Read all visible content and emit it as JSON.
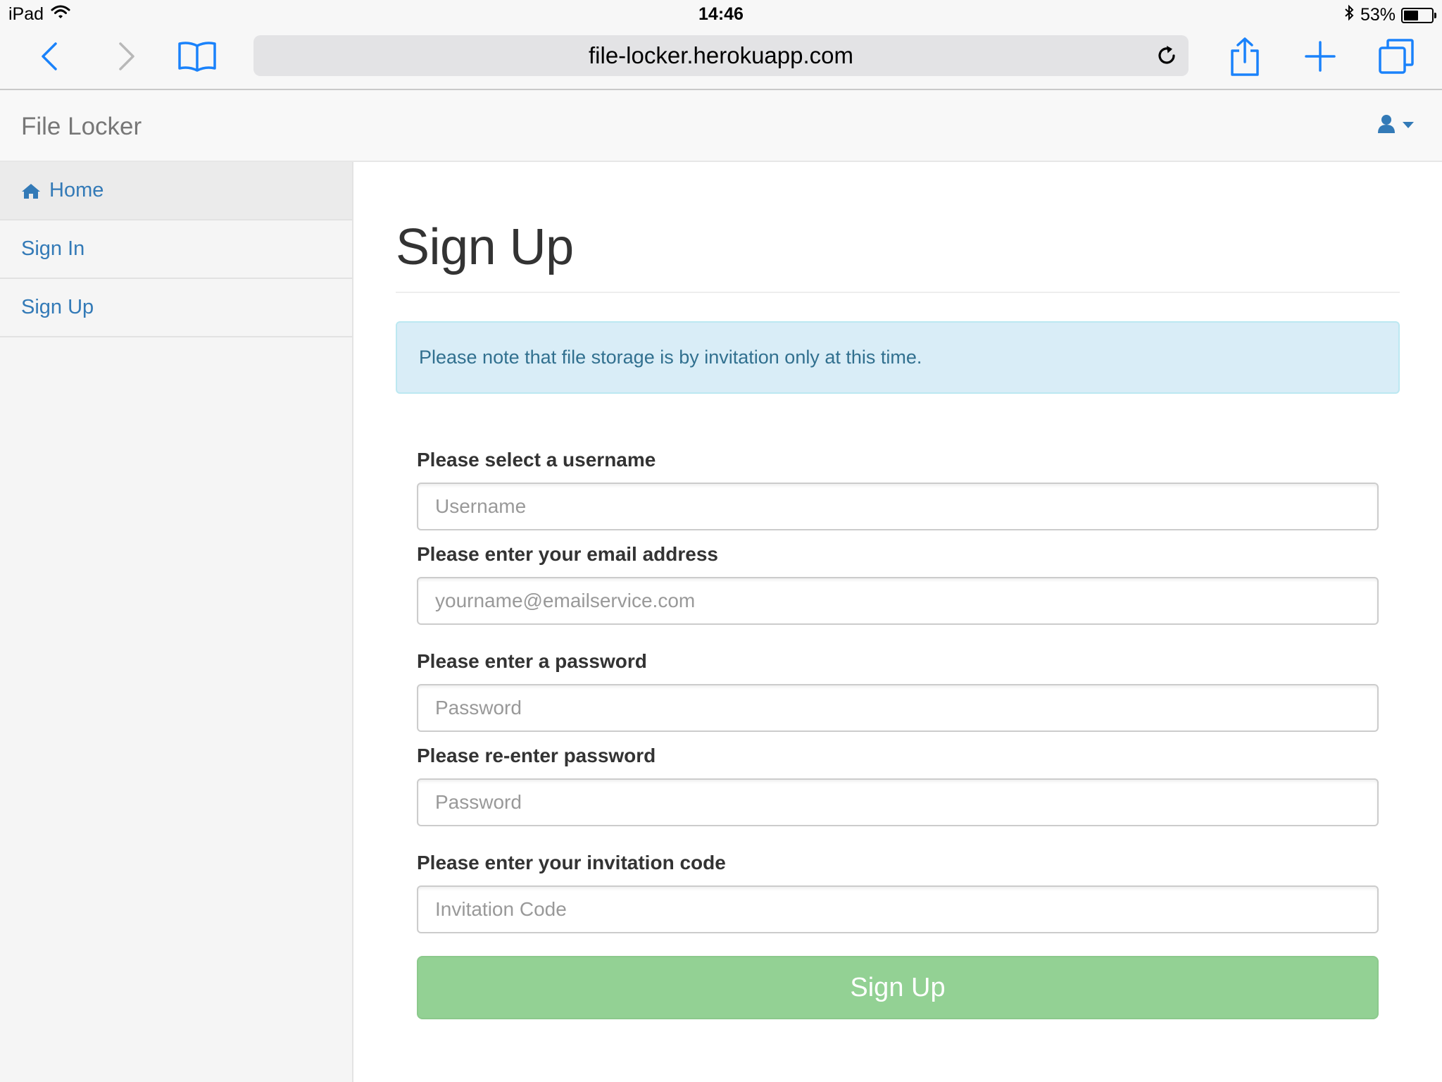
{
  "status_bar": {
    "device": "iPad",
    "time": "14:46",
    "battery_percent": "53%",
    "battery_level": 0.53
  },
  "browser": {
    "url": "file-locker.herokuapp.com",
    "icons": [
      "back-icon",
      "forward-icon",
      "bookmarks-icon",
      "reload-icon",
      "share-icon",
      "new-tab-icon",
      "tabs-icon"
    ]
  },
  "navbar": {
    "brand": "File Locker",
    "user_icon": "user-icon"
  },
  "sidebar": {
    "items": [
      {
        "label": "Home",
        "icon": "home-icon",
        "active": true
      },
      {
        "label": "Sign In"
      },
      {
        "label": "Sign Up"
      }
    ]
  },
  "main": {
    "title": "Sign Up",
    "alert": "Please note that file storage is by invitation only at this time.",
    "form": {
      "username_label": "Please select a username",
      "username_placeholder": "Username",
      "email_label": "Please enter your email address",
      "email_placeholder": "yourname@emailservice.com",
      "password_label": "Please enter a password",
      "password_placeholder": "Password",
      "password2_label": "Please re-enter password",
      "password2_placeholder": "Password",
      "invite_label": "Please enter your invitation code",
      "invite_placeholder": "Invitation Code",
      "submit_label": "Sign Up"
    }
  },
  "colors": {
    "link": "#337ab7",
    "alert_bg": "#d9edf7",
    "alert_text": "#31708f",
    "submit_bg": "#93d194",
    "ios_blue": "#1a82fb"
  }
}
